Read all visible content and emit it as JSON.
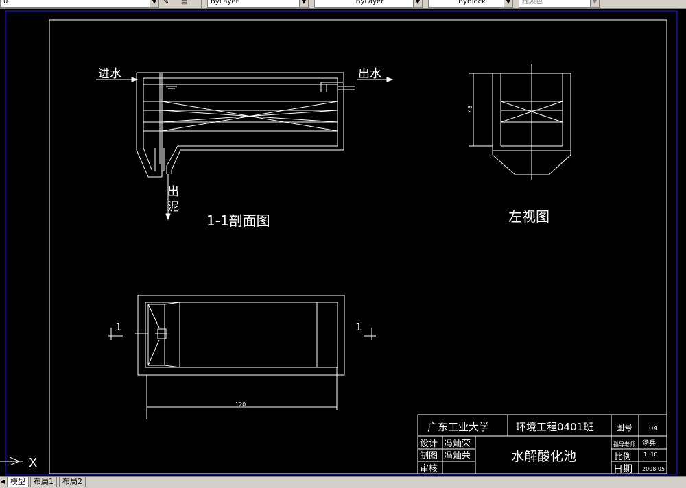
{
  "toolbar": {
    "layer_value": "0",
    "color_value": "ByLayer",
    "linetype_value": "ByLayer",
    "lineweight_value": "ByBlock",
    "plotstyle_value": "随颜色"
  },
  "section_view": {
    "water_in": "进水",
    "water_out": "出水",
    "sludge_out_1": "出",
    "sludge_out_2": "泥",
    "caption": "1-1剖面图"
  },
  "left_view": {
    "dimension": "45",
    "caption": "左视图"
  },
  "plan_view": {
    "cut_mark_left": "1",
    "cut_mark_right": "1",
    "dimension": "120"
  },
  "title_block": {
    "school": "广东工业大学",
    "class_name": "环境工程0401班",
    "drawing_no_label": "图号",
    "drawing_no": "04",
    "design_label": "设计",
    "design_name": "冯灿荣",
    "draft_label": "制图",
    "draft_name": "冯灿荣",
    "review_label": "审核",
    "drawing_title": "水解酸化池",
    "advisor_label": "指导老师",
    "advisor_name": "汤兵",
    "scale_label": "比例",
    "scale_value": "1: 10",
    "date_label": "日期",
    "date_value": "2008.05"
  },
  "ucs": {
    "x_label": "X"
  },
  "tabs": [
    "模型",
    "布局1",
    "布局2"
  ],
  "colors": {
    "background": "#000000",
    "lines": "#ffffff",
    "border": "#1a1aff"
  }
}
